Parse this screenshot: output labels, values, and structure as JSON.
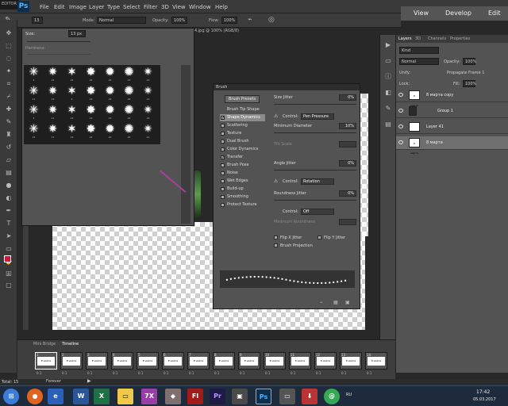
{
  "window": {
    "tab_label": "EDITOR",
    "app_logo": "Ps"
  },
  "menu": [
    "File",
    "Edit",
    "Image",
    "Layer",
    "Type",
    "Select",
    "Filter",
    "3D",
    "View",
    "Window",
    "Help"
  ],
  "workspace": {
    "items": [
      "View",
      "Develop",
      "Edit"
    ]
  },
  "options": {
    "size_value": "13",
    "mode_label": "Mode:",
    "mode_value": "Normal",
    "opacity_label": "Opacity:",
    "opacity_value": "100%",
    "flow_label": "Flow:",
    "flow_value": "100%"
  },
  "document": {
    "tab_title": "4.jpg @ 100% (RGB/8)"
  },
  "brush_picker": {
    "size_label": "Size:",
    "size_value": "13 px",
    "hardness_label": "Hardness:"
  },
  "brush_panel": {
    "title": "Brush",
    "presets_button": "Brush Presets",
    "options": [
      {
        "label": "Brush Tip Shape",
        "checked": false,
        "selected": false,
        "checkbox": false
      },
      {
        "label": "Shape Dynamics",
        "checked": true,
        "selected": true,
        "checkbox": true
      },
      {
        "label": "Scattering",
        "checked": false,
        "selected": false,
        "checkbox": true
      },
      {
        "label": "Texture",
        "checked": false,
        "selected": false,
        "checkbox": true
      },
      {
        "label": "Dual Brush",
        "checked": false,
        "selected": false,
        "checkbox": true
      },
      {
        "label": "Color Dynamics",
        "checked": false,
        "selected": false,
        "checkbox": true
      },
      {
        "label": "Transfer",
        "checked": true,
        "selected": false,
        "checkbox": true
      },
      {
        "label": "Brush Pose",
        "checked": false,
        "selected": false,
        "checkbox": true
      },
      {
        "label": "Noise",
        "checked": false,
        "selected": false,
        "checkbox": true
      },
      {
        "label": "Wet Edges",
        "checked": false,
        "selected": false,
        "checkbox": true
      },
      {
        "label": "Build-up",
        "checked": false,
        "selected": false,
        "checkbox": true
      },
      {
        "label": "Smoothing",
        "checked": false,
        "selected": false,
        "checkbox": true
      },
      {
        "label": "Protect Texture",
        "checked": false,
        "selected": false,
        "checkbox": true
      }
    ],
    "size_jitter_label": "Size Jitter",
    "size_jitter_value": "0%",
    "control_label": "Control:",
    "control_value": "Pen Pressure",
    "min_diameter_label": "Minimum Diameter",
    "min_diameter_value": "10%",
    "tilt_scale_label": "Tilt Scale",
    "angle_jitter_label": "Angle Jitter",
    "angle_jitter_value": "0%",
    "angle_control_value": "Rotation",
    "roundness_jitter_label": "Roundness Jitter",
    "roundness_jitter_value": "0%",
    "roundness_control_value": "Off",
    "min_roundness_label": "Minimum Roundness",
    "flip_x_label": "Flip X Jitter",
    "flip_y_label": "Flip Y Jitter",
    "projection_label": "Brush Projection"
  },
  "layers_panel": {
    "tabs": [
      "Layers",
      "3D",
      "Channels",
      "Properties"
    ],
    "kind_label": "Kind",
    "blend_mode": "Normal",
    "opacity_label": "Opacity:",
    "opacity_value": "100%",
    "unify_label": "Unify:",
    "propagate_label": "Propagate Frame 1",
    "lock_label": "Lock:",
    "fill_label": "Fill:",
    "fill_value": "100%",
    "layers": [
      {
        "name": "8 марта copy",
        "thumb": "8 марта",
        "selected": false
      },
      {
        "name": "Group 1",
        "thumb": "",
        "selected": false
      },
      {
        "name": "Layer 41",
        "thumb": "",
        "selected": false
      },
      {
        "name": "8 марта",
        "thumb": "8 марта",
        "selected": true
      }
    ]
  },
  "timeline": {
    "tabs": [
      "Mini Bridge",
      "Timeline"
    ],
    "loop_value": "Forever",
    "frames": [
      {
        "n": "1",
        "d": "0.1"
      },
      {
        "n": "2",
        "d": "0.1"
      },
      {
        "n": "3",
        "d": "0.1"
      },
      {
        "n": "4",
        "d": "0.1"
      },
      {
        "n": "5",
        "d": "0.1"
      },
      {
        "n": "6",
        "d": "0.1"
      },
      {
        "n": "7",
        "d": "0.1"
      },
      {
        "n": "8",
        "d": "0.1"
      },
      {
        "n": "9",
        "d": "0.1"
      },
      {
        "n": "10",
        "d": "0.1"
      },
      {
        "n": "11",
        "d": "0.1"
      },
      {
        "n": "12",
        "d": "0.1"
      },
      {
        "n": "13",
        "d": "0.1"
      },
      {
        "n": "14",
        "d": "0.1"
      }
    ],
    "frame_label": "8 марта"
  },
  "status": {
    "doc_size": "Total: 15"
  },
  "taskbar": {
    "lang": "RU",
    "time": "17:42",
    "date": "05.03.2017"
  },
  "brush_sizes": [
    "4",
    "25",
    "25",
    "25",
    "25",
    "23",
    "23",
    "11",
    "19",
    "9",
    "19",
    "29",
    "29",
    "12",
    "3",
    "11",
    "12",
    "19",
    "13",
    "22",
    "16",
    "15",
    "17",
    "19",
    "24",
    "20",
    "25",
    "21"
  ]
}
